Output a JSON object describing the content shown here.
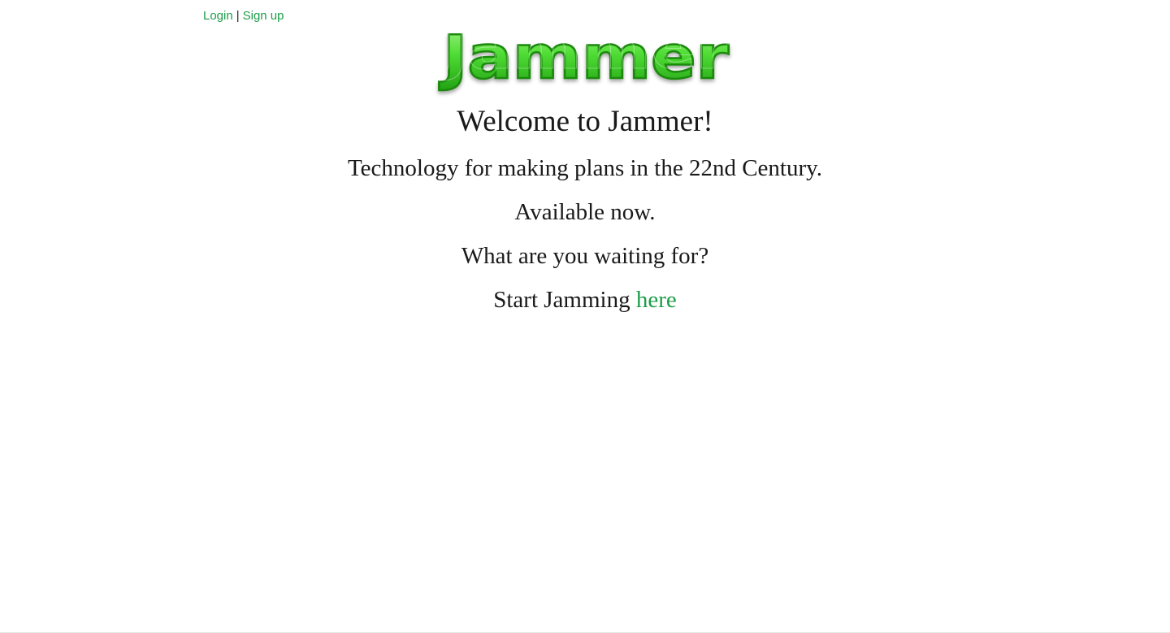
{
  "auth": {
    "login_label": "Login",
    "separator": "|",
    "signup_label": "Sign up"
  },
  "logo": {
    "text": "Jammer",
    "colors": {
      "fill": "#3fd32a",
      "fill_light": "#8ef06a",
      "fill_dark": "#1f9e12",
      "outline": "#1c8a10"
    }
  },
  "hero": {
    "welcome": "Welcome to Jammer!",
    "tagline": "Technology for making plans in the 22nd Century.",
    "availability": "Available now.",
    "question": "What are you waiting for?",
    "cta_prefix": "Start Jamming",
    "cta_link": "here"
  },
  "colors": {
    "link": "#1e9e4a",
    "text": "#1a1a1a",
    "background": "#ffffff"
  }
}
